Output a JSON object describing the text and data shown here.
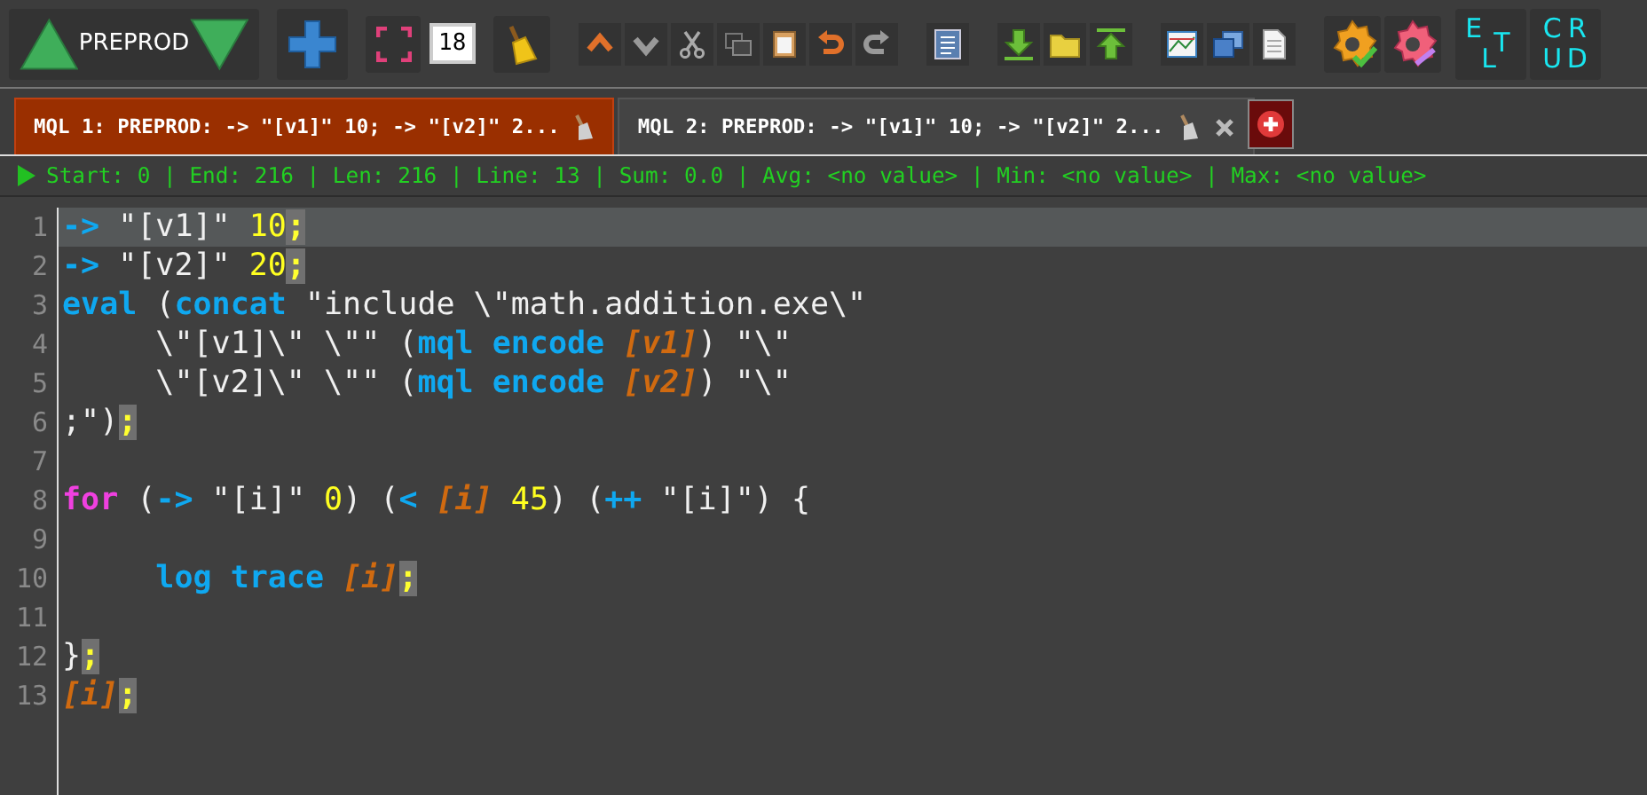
{
  "toolbar": {
    "environment": "PREPROD",
    "font_size": "18",
    "elt_letters": [
      "E",
      "L",
      "T"
    ],
    "crud_letters": [
      "C",
      "R",
      "U",
      "D"
    ]
  },
  "tabs": [
    {
      "label": "MQL 1: PREPROD: -> \"[v1]\" 10; -> \"[v2]\" 2...",
      "selected": true,
      "closable": false
    },
    {
      "label": "MQL 2: PREPROD: -> \"[v1]\" 10; -> \"[v2]\" 2...",
      "selected": false,
      "closable": true
    }
  ],
  "status_bar": "Start: 0 | End: 216 | Len: 216 | Line: 13 | Sum: 0.0 | Avg: <no value> | Min: <no value> | Max: <no value>",
  "editor": {
    "lines": [
      {
        "number": "1",
        "current": true,
        "tokens": [
          {
            "kind": "kw",
            "text": "->"
          },
          {
            "kind": "plain",
            "text": " \"[v1]\" "
          },
          {
            "kind": "num",
            "text": "10"
          },
          {
            "kind": "semi",
            "text": ";"
          }
        ]
      },
      {
        "number": "2",
        "current": false,
        "tokens": [
          {
            "kind": "kw",
            "text": "->"
          },
          {
            "kind": "plain",
            "text": " \"[v2]\" "
          },
          {
            "kind": "num",
            "text": "20"
          },
          {
            "kind": "semi",
            "text": ";"
          }
        ]
      },
      {
        "number": "3",
        "current": false,
        "tokens": [
          {
            "kind": "kw",
            "text": "eval"
          },
          {
            "kind": "plain",
            "text": " ("
          },
          {
            "kind": "kw",
            "text": "concat"
          },
          {
            "kind": "plain",
            "text": " \"include \\\"math.addition.exe\\\""
          }
        ]
      },
      {
        "number": "4",
        "current": false,
        "tokens": [
          {
            "kind": "plain",
            "text": "     \\\"[v1]\\\" \\\"\" ("
          },
          {
            "kind": "kw",
            "text": "mql encode"
          },
          {
            "kind": "var",
            "text": " [v1]"
          },
          {
            "kind": "plain",
            "text": ") \"\\\""
          }
        ]
      },
      {
        "number": "5",
        "current": false,
        "tokens": [
          {
            "kind": "plain",
            "text": "     \\\"[v2]\\\" \\\"\" ("
          },
          {
            "kind": "kw",
            "text": "mql encode"
          },
          {
            "kind": "var",
            "text": " [v2]"
          },
          {
            "kind": "plain",
            "text": ") \"\\\""
          }
        ]
      },
      {
        "number": "6",
        "current": false,
        "tokens": [
          {
            "kind": "plain",
            "text": ";\")"
          },
          {
            "kind": "semi",
            "text": ";"
          }
        ]
      },
      {
        "number": "7",
        "current": false
      },
      {
        "number": "8",
        "current": false,
        "tokens": [
          {
            "kind": "flow",
            "text": "for"
          },
          {
            "kind": "plain",
            "text": " ("
          },
          {
            "kind": "kw",
            "text": "->"
          },
          {
            "kind": "plain",
            "text": " \"[i]\" "
          },
          {
            "kind": "num",
            "text": "0"
          },
          {
            "kind": "plain",
            "text": ") ("
          },
          {
            "kind": "kw",
            "text": "<"
          },
          {
            "kind": "var",
            "text": " [i]"
          },
          {
            "kind": "num",
            "text": " 45"
          },
          {
            "kind": "plain",
            "text": ") ("
          },
          {
            "kind": "kw",
            "text": "++"
          },
          {
            "kind": "plain",
            "text": " \"[i]\") {"
          }
        ]
      },
      {
        "number": "9",
        "current": false
      },
      {
        "number": "10",
        "current": false,
        "tokens": [
          {
            "kind": "kw",
            "text": "     log trace"
          },
          {
            "kind": "var",
            "text": " [i]"
          },
          {
            "kind": "semi",
            "text": ";"
          }
        ]
      },
      {
        "number": "11",
        "current": false
      },
      {
        "number": "12",
        "current": false,
        "tokens": [
          {
            "kind": "plain",
            "text": "}"
          },
          {
            "kind": "semi",
            "text": ";"
          }
        ]
      },
      {
        "number": "13",
        "current": false,
        "tokens": [
          {
            "kind": "var",
            "text": "[i]"
          },
          {
            "kind": "semi",
            "text": ";"
          }
        ]
      }
    ]
  }
}
